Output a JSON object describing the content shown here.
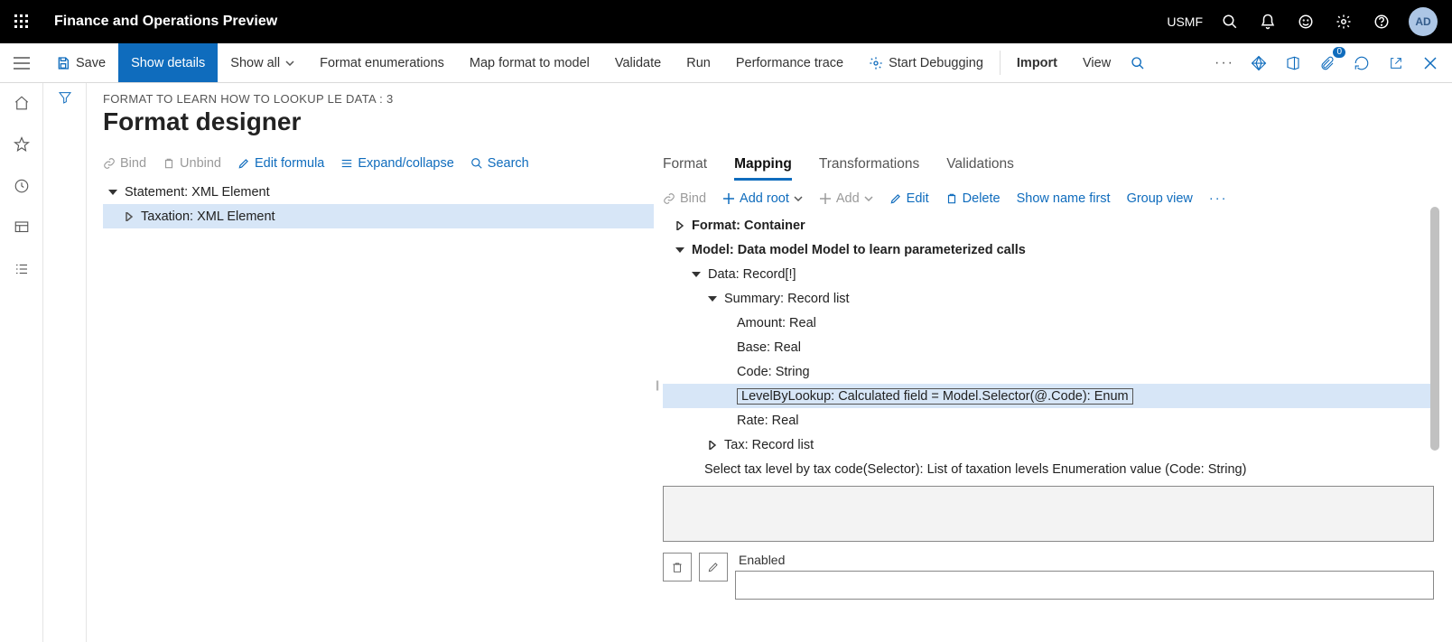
{
  "topbar": {
    "app_title": "Finance and Operations Preview",
    "entity": "USMF",
    "avatar": "AD"
  },
  "cmdbar": {
    "save": "Save",
    "show_details": "Show details",
    "show_all": "Show all",
    "format_enums": "Format enumerations",
    "map_format": "Map format to model",
    "validate": "Validate",
    "run": "Run",
    "perf_trace": "Performance trace",
    "start_debug": "Start Debugging",
    "import": "Import",
    "view": "View",
    "badge_count": "0"
  },
  "page": {
    "breadcrumb": "FORMAT TO LEARN HOW TO LOOKUP LE DATA : 3",
    "title": "Format designer"
  },
  "left_toolbar": {
    "bind": "Bind",
    "unbind": "Unbind",
    "edit_formula": "Edit formula",
    "expand": "Expand/collapse",
    "search": "Search"
  },
  "format_tree": {
    "root": "Statement: XML Element",
    "child": "Taxation: XML Element"
  },
  "tabs": {
    "format": "Format",
    "mapping": "Mapping",
    "transformations": "Transformations",
    "validations": "Validations"
  },
  "right_toolbar": {
    "bind": "Bind",
    "add_root": "Add root",
    "add": "Add",
    "edit": "Edit",
    "delete": "Delete",
    "show_name_first": "Show name first",
    "group_view": "Group view"
  },
  "mapping_tree": {
    "n0": "Format: Container",
    "n1": "Model: Data model Model to learn parameterized calls",
    "n2": "Data: Record[!]",
    "n3": "Summary: Record list",
    "n4": "Amount: Real",
    "n5": "Base: Real",
    "n6": "Code: String",
    "n7": "LevelByLookup: Calculated field = Model.Selector(@.Code): Enum",
    "n8": "Rate: Real",
    "n9": "Tax: Record list",
    "desc": "Select tax level by tax code(Selector): List of taxation levels Enumeration value (Code: String)"
  },
  "enabled_label": "Enabled"
}
